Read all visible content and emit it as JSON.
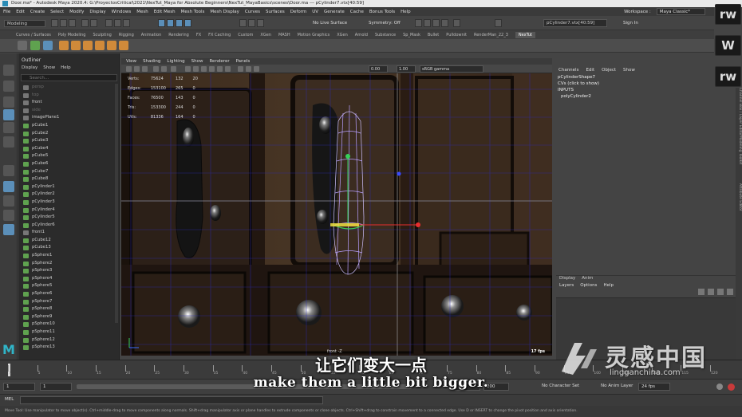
{
  "window": {
    "title": "Door.ma* - Autodesk Maya 2020.4: G:\\ProyectosCritical\\2021\\NexTut_Maya for Absolute Beginners\\NexTut_MayaBasics\\scenes\\Door.ma  ---  pCylinder7.vtx[40:59]"
  },
  "menubar": {
    "items": [
      "File",
      "Edit",
      "Create",
      "Select",
      "Modify",
      "Display",
      "Windows",
      "Mesh",
      "Edit Mesh",
      "Mesh Tools",
      "Mesh Display",
      "Curves",
      "Surfaces",
      "Deform",
      "UV",
      "Generate",
      "Cache",
      "Bonus Tools",
      "Help"
    ],
    "workspace_label": "Workspace :",
    "workspace_value": "Maya Classic*"
  },
  "statusline": {
    "mode": "Modeling",
    "live_surface": "No Live Surface",
    "symmetry": "Symmetry: Off",
    "selection_field": "pCylinder7.vtx[40:59]",
    "sign_in": "Sign In"
  },
  "shelf": {
    "tabs": [
      "Curves / Surfaces",
      "Poly Modeling",
      "Sculpting",
      "Rigging",
      "Animation",
      "Rendering",
      "FX",
      "FX Caching",
      "Custom",
      "XGen",
      "MASH",
      "Motion Graphics",
      "XGen",
      "Arnold",
      "Substance",
      "Sp_Mask",
      "Bullet",
      "Pulldownit",
      "RenderMan_22_3",
      "NexTut"
    ],
    "active_tab": "NexTut"
  },
  "outliner": {
    "title": "Outliner",
    "menu": [
      "Display",
      "Show",
      "Help"
    ],
    "search_placeholder": "Search...",
    "items": [
      "persp",
      "top",
      "front",
      "side",
      "imagePlane1",
      "pCube1",
      "pCube2",
      "pCube3",
      "pCube4",
      "pCube5",
      "pCube6",
      "pCube7",
      "pCube8",
      "pCylinder1",
      "pCylinder2",
      "pCylinder3",
      "pCylinder4",
      "pCylinder5",
      "pCylinder6",
      "front1",
      "pCube12",
      "pCube13",
      "pSphere1",
      "pSphere2",
      "pSphere3",
      "pSphere4",
      "pSphere5",
      "pSphere6",
      "pSphere7",
      "pSphere8",
      "pSphere9",
      "pSphere10",
      "pSphere11",
      "pSphere12",
      "pSphere13"
    ],
    "dim_items": [
      "persp",
      "top",
      "side"
    ]
  },
  "viewport": {
    "menu": [
      "View",
      "Shading",
      "Lighting",
      "Show",
      "Renderer",
      "Panels"
    ],
    "gamma_field": "sRGB gamma",
    "exposure_value": "0.00",
    "gamma_value": "1.00",
    "hud": [
      {
        "label": "Verts:",
        "a": "75624",
        "b": "132",
        "c": "20"
      },
      {
        "label": "Edges:",
        "a": "153100",
        "b": "265",
        "c": "0"
      },
      {
        "label": "Faces:",
        "a": "76500",
        "b": "143",
        "c": "0"
      },
      {
        "label": "Tris:",
        "a": "153300",
        "b": "244",
        "c": "0"
      },
      {
        "label": "UVs:",
        "a": "81336",
        "b": "164",
        "c": "0"
      }
    ],
    "camera_label": "front -Z",
    "fps": "17 fps"
  },
  "channel_box": {
    "menu": [
      "Channels",
      "Edit",
      "Object",
      "Show"
    ],
    "shape_name": "pCylinderShape7",
    "cvs_label": "CVs (click to show)",
    "inputs_label": "INPUTS",
    "input_node": "polyCylinder2"
  },
  "layer_editor": {
    "tabs": [
      "Display",
      "Anim"
    ],
    "menu": [
      "Layers",
      "Options",
      "Help"
    ]
  },
  "side_tabs": [
    "Channel Box / Layer Editor",
    "Modeling Toolkit",
    "Attribute Editor"
  ],
  "timeline": {
    "frame_ticks": [
      "1",
      "5",
      "10",
      "15",
      "20",
      "25",
      "30",
      "35",
      "40",
      "45",
      "50",
      "55",
      "60",
      "65",
      "70",
      "75",
      "80",
      "85",
      "90",
      "95",
      "100",
      "105",
      "110",
      "115",
      "120"
    ],
    "current_frame": "1"
  },
  "range": {
    "start": "1",
    "start2": "1",
    "end": "120",
    "end2": "200",
    "character_set": "No Character Set",
    "anim_layer": "No Anim Layer",
    "fps_setting": "24 fps"
  },
  "command_line": {
    "mode_label": "MEL"
  },
  "help_line": "Move Tool: Use manipulator to move object(s). Ctrl+middle-drag to move components along normals. Shift+drag manipulator axis or plane handles to extrude components or clone objects. Ctrl+Shift+drag to constrain movement to a connected edge. Use D or INSERT to change the pivot position and axis orientation.",
  "subtitles": {
    "chinese": "让它们变大一点",
    "english": "make them a little bit bigger."
  },
  "watermark": {
    "chinese": "灵感中国",
    "english": "lingganchina.com"
  },
  "logos": [
    "rw",
    "W",
    "rw"
  ],
  "colors": {
    "accent_teal": "#30b5c8",
    "selection_green": "#37d05a",
    "wire_purple": "#b8a0ff",
    "wood_dark": "#2d1e14"
  }
}
